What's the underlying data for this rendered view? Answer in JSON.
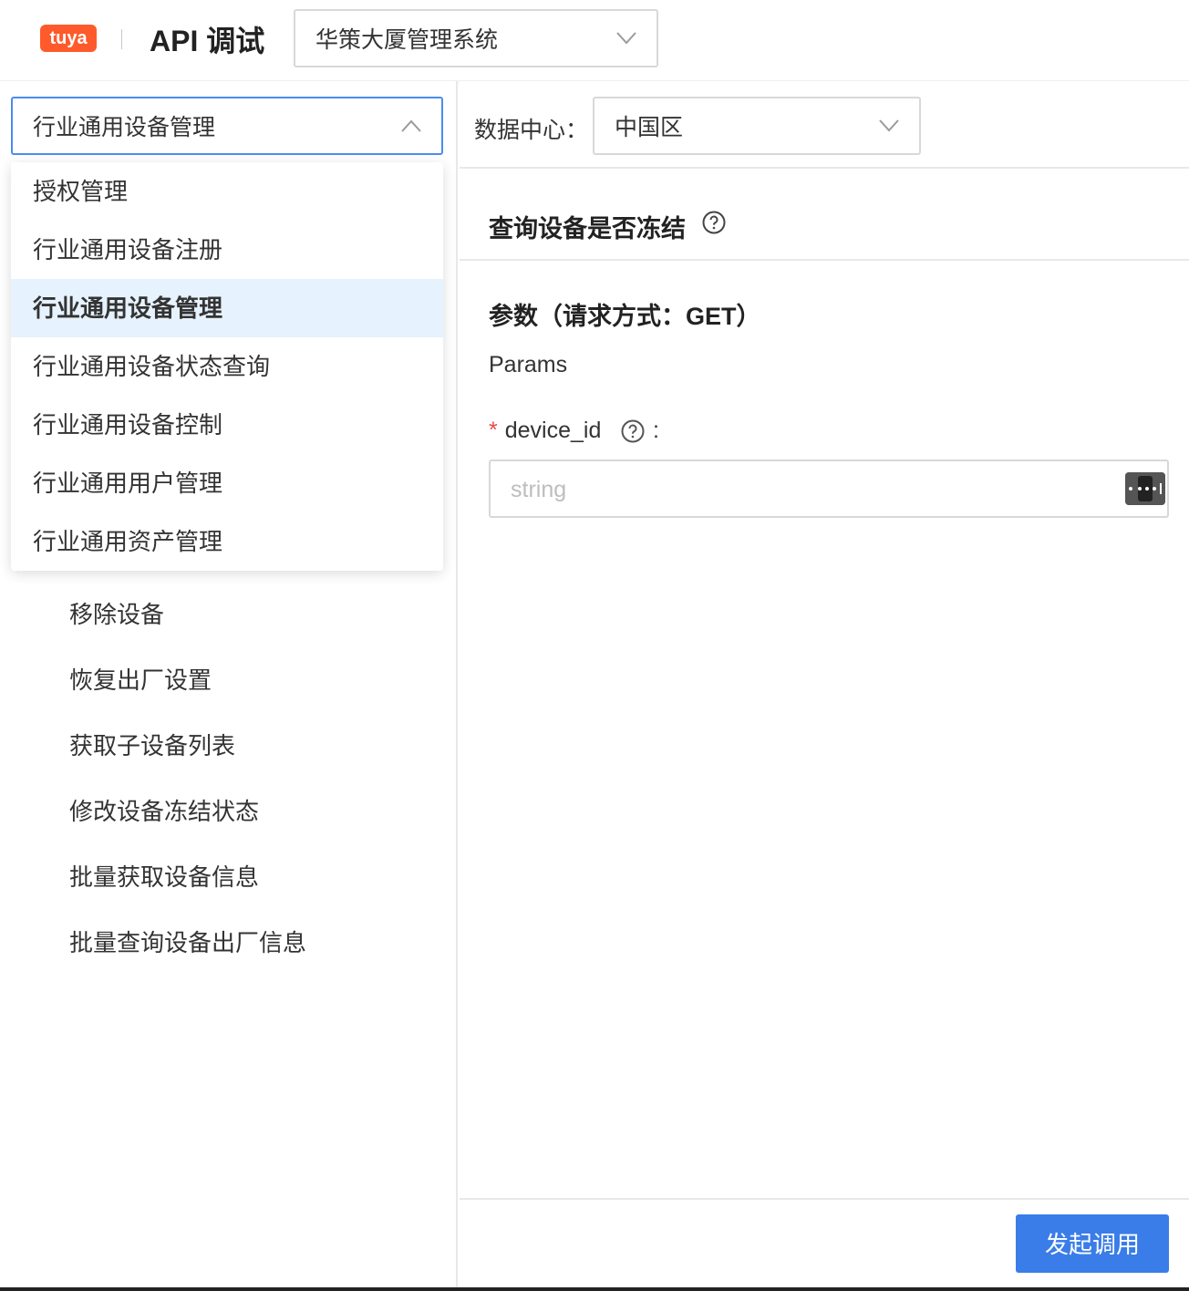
{
  "header": {
    "logo_text": "tuya",
    "title": "API 调试",
    "project_select": {
      "value": "华策大厦管理系统"
    }
  },
  "left_panel": {
    "category_select": {
      "value": "行业通用设备管理",
      "expanded": true
    },
    "dropdown_options": [
      {
        "label": "授权管理",
        "selected": false
      },
      {
        "label": "行业通用设备注册",
        "selected": false
      },
      {
        "label": "行业通用设备管理",
        "selected": true
      },
      {
        "label": "行业通用设备状态查询",
        "selected": false
      },
      {
        "label": "行业通用设备控制",
        "selected": false
      },
      {
        "label": "行业通用用户管理",
        "selected": false
      },
      {
        "label": "行业通用资产管理",
        "selected": false
      }
    ],
    "api_list": [
      "移除设备",
      "恢复出厂设置",
      "获取子设备列表",
      "修改设备冻结状态",
      "批量获取设备信息",
      "批量查询设备出厂信息"
    ]
  },
  "right_panel": {
    "data_center": {
      "label": "数据中心：",
      "value": "中国区"
    },
    "api_title": "查询设备是否冻结",
    "params_title": "参数（请求方式：GET）",
    "params_subtitle": "Params",
    "fields": [
      {
        "name": "device_id",
        "required": true,
        "required_mark": "*",
        "colon": ":",
        "placeholder": "string",
        "value": ""
      }
    ],
    "invoke_button": "发起调用"
  },
  "colors": {
    "brand_orange": "#ff5a2b",
    "primary_blue": "#3a7de8",
    "focus_border": "#4a8cf0",
    "selected_option_bg": "#e6f2fd",
    "required_red": "#e84a4a"
  },
  "icons": [
    "tuya-logo",
    "chevron-down-icon",
    "chevron-up-icon",
    "help-circle-icon",
    "password-key-icon"
  ]
}
